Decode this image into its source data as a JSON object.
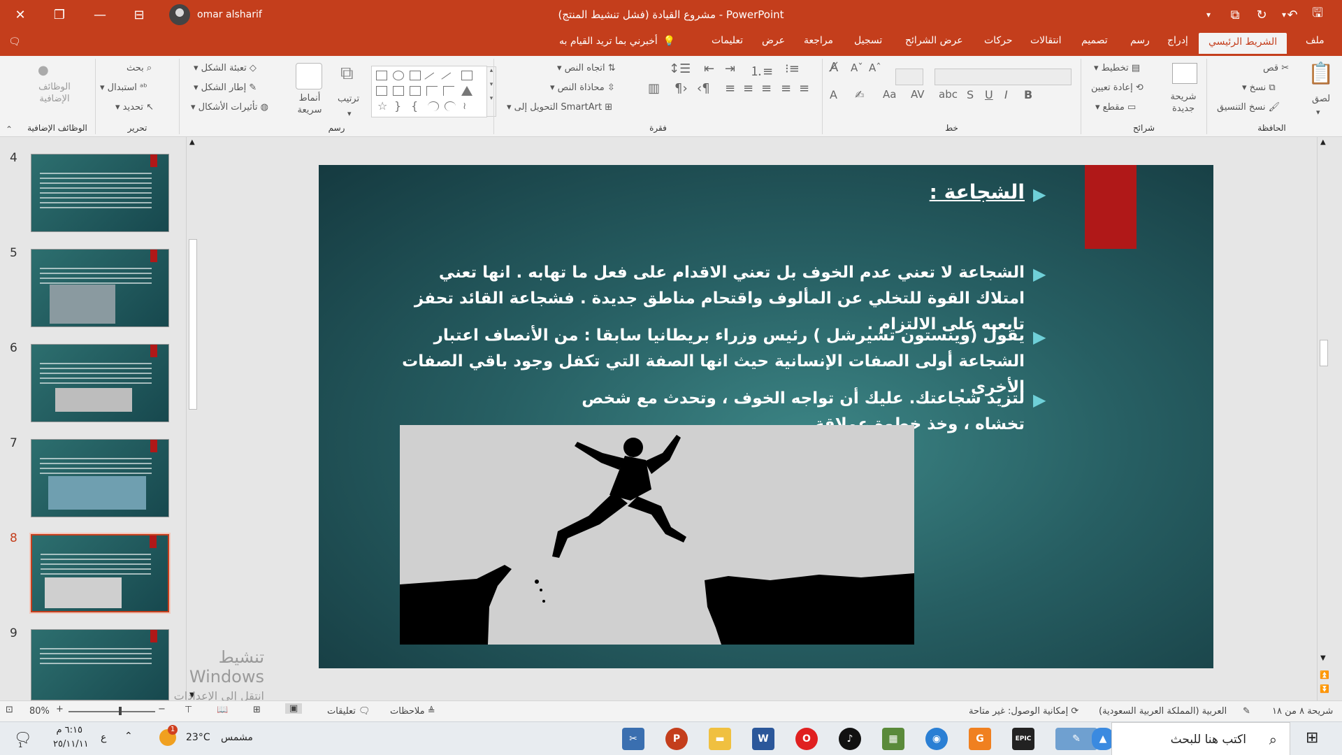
{
  "titlebar": {
    "doc_title": "مشروع القيادة (فشل تنشيط المنتج) - PowerPoint",
    "user_name": "omar alsharif"
  },
  "tabs": [
    {
      "label": "ملف",
      "active": false
    },
    {
      "label": "الشريط الرئيسي",
      "active": true
    },
    {
      "label": "إدراج",
      "active": false
    },
    {
      "label": "رسم",
      "active": false
    },
    {
      "label": "تصميم",
      "active": false
    },
    {
      "label": "انتقالات",
      "active": false
    },
    {
      "label": "حركات",
      "active": false
    },
    {
      "label": "عرض الشرائح",
      "active": false
    },
    {
      "label": "تسجيل",
      "active": false
    },
    {
      "label": "مراجعة",
      "active": false
    },
    {
      "label": "عرض",
      "active": false
    },
    {
      "label": "تعليمات",
      "active": false
    }
  ],
  "tellme": "أخبرني بما تريد القيام به",
  "ribbon": {
    "groups": {
      "clipboard": "الحافظة",
      "slides": "شرائح",
      "font": "خط",
      "paragraph": "فقرة",
      "drawing": "رسم",
      "editing": "تحرير",
      "addins": "الوظائف الإضافية"
    },
    "clipboard": {
      "paste": "لصق",
      "cut": "قص",
      "copy": "نسخ",
      "format_painter": "نسخ التنسيق"
    },
    "slides": {
      "new_slide": "شريحة جديدة",
      "layout": "تخطيط",
      "reset": "إعادة تعيين",
      "section": "مقطع"
    },
    "paragraph": {
      "text_direction": "اتجاه النص",
      "align_text": "محاذاة النص",
      "smartart": "التحويل إلى SmartArt"
    },
    "drawing": {
      "arrange": "ترتيب",
      "quick_styles": "أنماط سريعة",
      "shape_fill": "تعبئة الشكل",
      "shape_outline": "إطار الشكل",
      "shape_effects": "تأثيرات الأشكال"
    },
    "editing": {
      "find": "بحث",
      "replace": "استبدال",
      "select": "تحديد"
    },
    "addins": {
      "label": "الوظائف الإضافية"
    }
  },
  "thumbnails": [
    {
      "num": "4",
      "title": "تعريف الخبرة أو ماهي الخبرة",
      "active": false,
      "image": "none"
    },
    {
      "num": "5",
      "title": "للقائد الخبير خصائص ومزايا يتميز بها ومنها :",
      "active": false,
      "image": "people"
    },
    {
      "num": "6",
      "title": "المثالية :",
      "active": false,
      "image": "scale"
    },
    {
      "num": "7",
      "title": "التفاؤل :",
      "active": false,
      "image": "stairs"
    },
    {
      "num": "8",
      "title": "الشجاعة :",
      "active": true,
      "image": "jump"
    },
    {
      "num": "9",
      "title": "المبادرة :",
      "active": false,
      "image": "photo"
    }
  ],
  "slide": {
    "title": "الشجاعة :",
    "bullets": [
      "الشجاعة لا تعني عدم الخوف بل تعني الاقدام على فعل ما تهابه . انها تعني امتلاك القوة للتخلي عن المألوف واقتحام مناطق جديدة . فشجاعة القائد تحفز تابعيه على الالتزام .",
      "يقول (وينستون تشيرشل ) رئيس وزراء بريطانيا سابقا : من الأنصاف اعتبار الشجاعة أولى الصفات الإنسانية حيث انها الصفة التي تكفل وجود باقي الصفات الأخرى .",
      "لتزيد شجاعتك. عليك أن تواجه الخوف ، وتحدث مع شخص تخشاه ، وخذ خطوة عملاقة ."
    ]
  },
  "watermark": {
    "line1": "تنشيط Windows",
    "line2": "انتقل إلى الإعدادات لتنشيط Windows"
  },
  "statusbar": {
    "slide_of": "شريحة ٨ من ١٨",
    "language": "العربية (المملكة العربية السعودية)",
    "accessibility": "إمكانية الوصول: غير متاحة",
    "notes": "ملاحظات",
    "comments": "تعليقات",
    "zoom": "80%"
  },
  "taskbar": {
    "search_placeholder": "اكتب هنا للبحث",
    "weather_temp": "23°C",
    "weather_desc": "مشمس",
    "weather_badge": "1",
    "time": "٦:١٥ م",
    "date": "٢٥/١١/١١",
    "lang": "ع",
    "notif_count": "1"
  },
  "colors": {
    "accent": "#c43e1c",
    "slide_red": "#b01818",
    "bullet_arrow": "#6fd0d8"
  }
}
